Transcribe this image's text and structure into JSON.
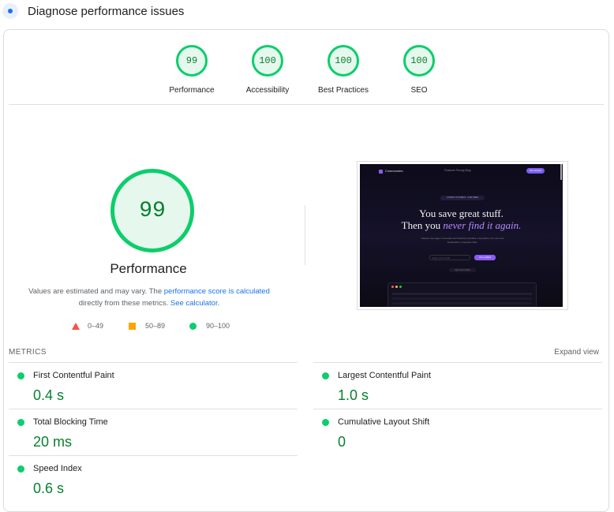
{
  "header": {
    "title": "Diagnose performance issues",
    "icon": "lighthouse-icon"
  },
  "scores": [
    {
      "value": "99",
      "label": "Performance"
    },
    {
      "value": "100",
      "label": "Accessibility"
    },
    {
      "value": "100",
      "label": "Best Practices"
    },
    {
      "value": "100",
      "label": "SEO"
    }
  ],
  "main_gauge": {
    "value": "99",
    "title": "Performance"
  },
  "note": {
    "text1": "Values are estimated and may vary. The ",
    "link1": "performance score is calculated",
    "text2": " directly from these metrics. ",
    "link2": "See calculator",
    "text3": "."
  },
  "legend": [
    {
      "range": "0–49",
      "color": "#ff4e42",
      "shape": "triangle"
    },
    {
      "range": "50–89",
      "color": "#ffa400",
      "shape": "square"
    },
    {
      "range": "90–100",
      "color": "#0cce6b",
      "shape": "circle"
    }
  ],
  "screenshot": {
    "brand": "Cosmonotes",
    "nav": "Features   Pricing   Blog",
    "button": "Get started",
    "pill": "COSMIC IS IN BETA · JOIN FREE",
    "headline_line1": "You save great stuff.",
    "headline_line2_a": "Then you ",
    "headline_line2_em": "never find it again.",
    "subtext": "Capture any page in seconds and instantly resurface it anywhere. No more lost bookmarks or forgotten tabs.",
    "input_placeholder": "Enter your email",
    "cta": "Join waitlist",
    "small_link": "See how it works"
  },
  "metrics": {
    "label": "METRICS",
    "expand": "Expand view",
    "items": [
      {
        "name": "First Contentful Paint",
        "value": "0.4 s"
      },
      {
        "name": "Largest Contentful Paint",
        "value": "1.0 s"
      },
      {
        "name": "Total Blocking Time",
        "value": "20 ms"
      },
      {
        "name": "Cumulative Layout Shift",
        "value": "0"
      },
      {
        "name": "Speed Index",
        "value": "0.6 s"
      }
    ]
  },
  "colors": {
    "pass": "#0cce6b",
    "pass_text": "#08802e",
    "link": "#1a73e8"
  }
}
